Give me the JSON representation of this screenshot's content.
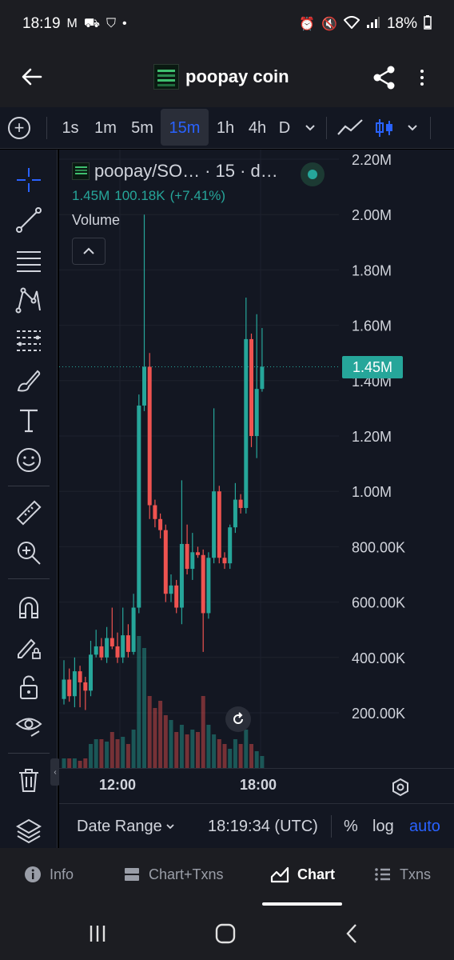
{
  "status_bar": {
    "time": "18:19",
    "battery": "18%"
  },
  "header": {
    "title": "poopay coin"
  },
  "toolbar": {
    "timeframes": [
      "1s",
      "1m",
      "5m",
      "15m",
      "1h",
      "4h",
      "D"
    ],
    "active_timeframe": "15m"
  },
  "legend": {
    "symbol": "poopay/SO…",
    "interval": "· 15 · d…",
    "volume_value": "1.45M",
    "change_value": "100.18K",
    "change_percent": "(+7.41%)",
    "volume_label": "Volume"
  },
  "colors": {
    "up": "#26a69a",
    "down": "#ef5350",
    "accent": "#2962ff",
    "background": "#131722"
  },
  "chart_data": {
    "type": "bar",
    "series_name": "Volume",
    "y_ticks": [
      "2.20M",
      "2.00M",
      "1.80M",
      "1.60M",
      "1.40M",
      "1.20M",
      "1.00M",
      "800.00K",
      "600.00K",
      "400.00K",
      "200.00K"
    ],
    "ylim": [
      0,
      2200000
    ],
    "x_ticks": [
      "12:00",
      "18:00"
    ],
    "current_value": 1450000,
    "current_label": "1.45M",
    "candles": [
      {
        "o": 250000,
        "c": 320000,
        "h": 390000,
        "l": 230000
      },
      {
        "o": 320000,
        "c": 260000,
        "h": 360000,
        "l": 240000
      },
      {
        "o": 260000,
        "c": 350000,
        "h": 400000,
        "l": 220000
      },
      {
        "o": 350000,
        "c": 310000,
        "h": 370000,
        "l": 220000
      },
      {
        "o": 310000,
        "c": 280000,
        "h": 330000,
        "l": 210000
      },
      {
        "o": 280000,
        "c": 410000,
        "h": 460000,
        "l": 260000
      },
      {
        "o": 410000,
        "c": 440000,
        "h": 500000,
        "l": 400000
      },
      {
        "o": 440000,
        "c": 400000,
        "h": 470000,
        "l": 390000
      },
      {
        "o": 400000,
        "c": 470000,
        "h": 510000,
        "l": 380000
      },
      {
        "o": 470000,
        "c": 440000,
        "h": 580000,
        "l": 430000
      },
      {
        "o": 440000,
        "c": 400000,
        "h": 490000,
        "l": 380000
      },
      {
        "o": 400000,
        "c": 480000,
        "h": 580000,
        "l": 380000
      },
      {
        "o": 480000,
        "c": 420000,
        "h": 520000,
        "l": 400000
      },
      {
        "o": 420000,
        "c": 580000,
        "h": 630000,
        "l": 410000
      },
      {
        "o": 580000,
        "c": 1310000,
        "h": 1350000,
        "l": 560000
      },
      {
        "o": 1310000,
        "c": 1450000,
        "h": 2000000,
        "l": 1290000
      },
      {
        "o": 1450000,
        "c": 950000,
        "h": 1500000,
        "l": 900000
      },
      {
        "o": 950000,
        "c": 900000,
        "h": 970000,
        "l": 870000
      },
      {
        "o": 900000,
        "c": 860000,
        "h": 920000,
        "l": 830000
      },
      {
        "o": 860000,
        "c": 630000,
        "h": 880000,
        "l": 600000
      },
      {
        "o": 630000,
        "c": 660000,
        "h": 700000,
        "l": 600000
      },
      {
        "o": 660000,
        "c": 580000,
        "h": 680000,
        "l": 560000
      },
      {
        "o": 580000,
        "c": 810000,
        "h": 1040000,
        "l": 520000
      },
      {
        "o": 810000,
        "c": 720000,
        "h": 880000,
        "l": 700000
      },
      {
        "o": 720000,
        "c": 780000,
        "h": 850000,
        "l": 680000
      },
      {
        "o": 780000,
        "c": 770000,
        "h": 800000,
        "l": 760000
      },
      {
        "o": 770000,
        "c": 560000,
        "h": 790000,
        "l": 420000
      },
      {
        "o": 560000,
        "c": 760000,
        "h": 780000,
        "l": 540000
      },
      {
        "o": 760000,
        "c": 1000000,
        "h": 1300000,
        "l": 740000
      },
      {
        "o": 1000000,
        "c": 760000,
        "h": 1020000,
        "l": 740000
      },
      {
        "o": 760000,
        "c": 740000,
        "h": 780000,
        "l": 720000
      },
      {
        "o": 740000,
        "c": 870000,
        "h": 880000,
        "l": 720000
      },
      {
        "o": 870000,
        "c": 970000,
        "h": 1030000,
        "l": 850000
      },
      {
        "o": 970000,
        "c": 940000,
        "h": 990000,
        "l": 920000
      },
      {
        "o": 940000,
        "c": 1550000,
        "h": 1700000,
        "l": 920000
      },
      {
        "o": 1550000,
        "c": 1200000,
        "h": 1570000,
        "l": 1160000
      },
      {
        "o": 1200000,
        "c": 1370000,
        "h": 1640000,
        "l": 1120000
      },
      {
        "o": 1370000,
        "c": 1450000,
        "h": 1590000,
        "l": 1360000
      }
    ],
    "volumes": [
      0.04,
      0.04,
      0.04,
      0.03,
      0.04,
      0.1,
      0.12,
      0.12,
      0.11,
      0.15,
      0.12,
      0.13,
      0.1,
      0.16,
      0.55,
      0.5,
      0.3,
      0.25,
      0.28,
      0.22,
      0.2,
      0.15,
      0.18,
      0.14,
      0.16,
      0.15,
      0.3,
      0.18,
      0.14,
      0.12,
      0.1,
      0.08,
      0.12,
      0.1,
      0.16,
      0.1,
      0.07,
      0.05
    ]
  },
  "time_axis": {
    "labels": [
      "12:00",
      "18:00"
    ]
  },
  "bottom_toolbar": {
    "date_range": "Date Range",
    "time": "18:19:34 (UTC)",
    "percent": "%",
    "log": "log",
    "auto": "auto"
  },
  "tabs": [
    {
      "label": "Info",
      "icon": "info-icon"
    },
    {
      "label": "Chart+Txns",
      "icon": "split-view-icon"
    },
    {
      "label": "Chart",
      "icon": "chart-icon"
    },
    {
      "label": "Txns",
      "icon": "list-icon"
    }
  ],
  "active_tab": "Chart"
}
